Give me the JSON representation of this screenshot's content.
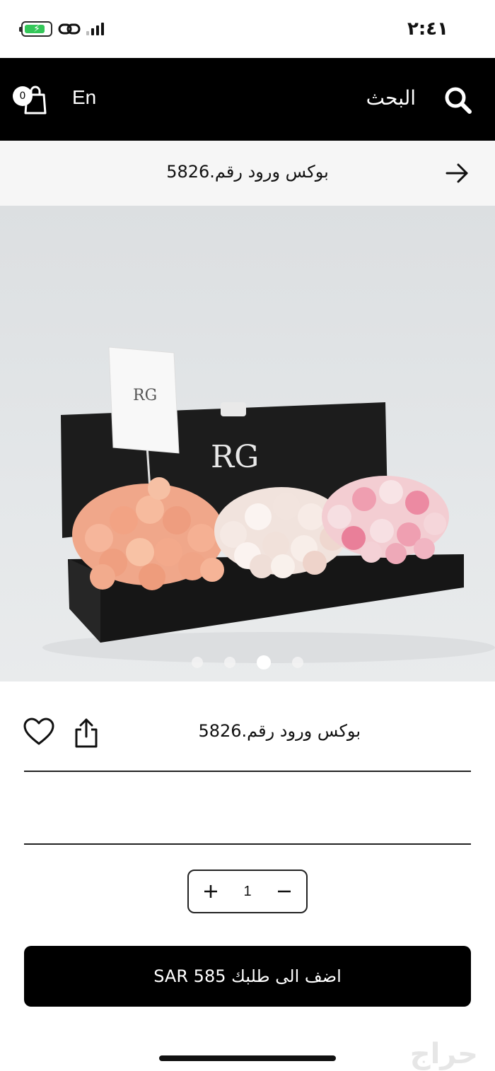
{
  "status_bar": {
    "time": "٢:٤١"
  },
  "header": {
    "cart_count": "0",
    "language_toggle": "En",
    "search_label": "البحث"
  },
  "title_bar": {
    "title": "بوكس ورود رقم.5826"
  },
  "gallery": {
    "slide_count": 4,
    "active_index": 2
  },
  "product": {
    "name": "بوكس ورود رقم.5826",
    "quantity": "1",
    "add_to_cart_label": "اضف الى طلبك 585 SAR"
  },
  "watermark": {
    "text": "حراج"
  },
  "colors": {
    "header_bg": "#000000",
    "button_bg": "#000000",
    "accent_battery": "#34c759"
  }
}
